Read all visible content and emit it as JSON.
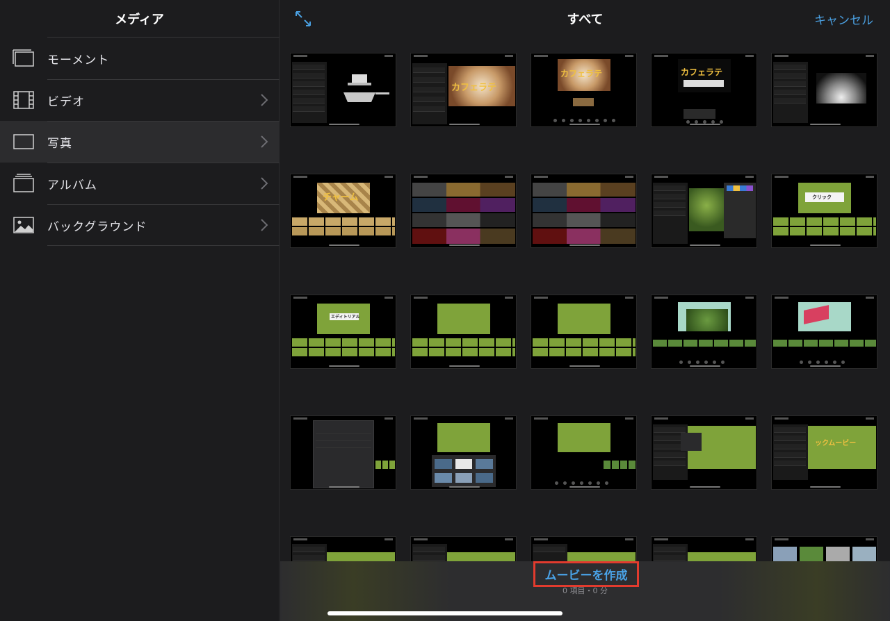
{
  "sidebar": {
    "title": "メディア",
    "items": [
      {
        "label": "モーメント",
        "icon": "moments-icon",
        "chevron": false,
        "selected": false
      },
      {
        "label": "ビデオ",
        "icon": "film-icon",
        "chevron": true,
        "selected": false
      },
      {
        "label": "写真",
        "icon": "photo-frame-icon",
        "chevron": true,
        "selected": true
      },
      {
        "label": "アルバム",
        "icon": "album-stack-icon",
        "chevron": true,
        "selected": false
      },
      {
        "label": "バックグラウンド",
        "icon": "landscape-image-icon",
        "chevron": true,
        "selected": false
      }
    ]
  },
  "topbar": {
    "title": "すべて",
    "cancel_label": "キャンセル",
    "expand_icon": "expand-arrows-icon"
  },
  "grid": {
    "captions": {
      "r0c1": "カフェラテ",
      "r0c2": "カフェラテ",
      "r0c3": "カフェラテ",
      "r1c0": "チャーム",
      "r1c4": "クリック",
      "r2c0": "エディトリアル",
      "r3c4": "ックムービー"
    }
  },
  "bottom": {
    "make_movie_label": "ムービーを作成",
    "count_label": "0 項目・0 分"
  },
  "colors": {
    "accent": "#4a9fe0",
    "highlight_border": "#e23b2e",
    "background": "#1c1c1e"
  }
}
